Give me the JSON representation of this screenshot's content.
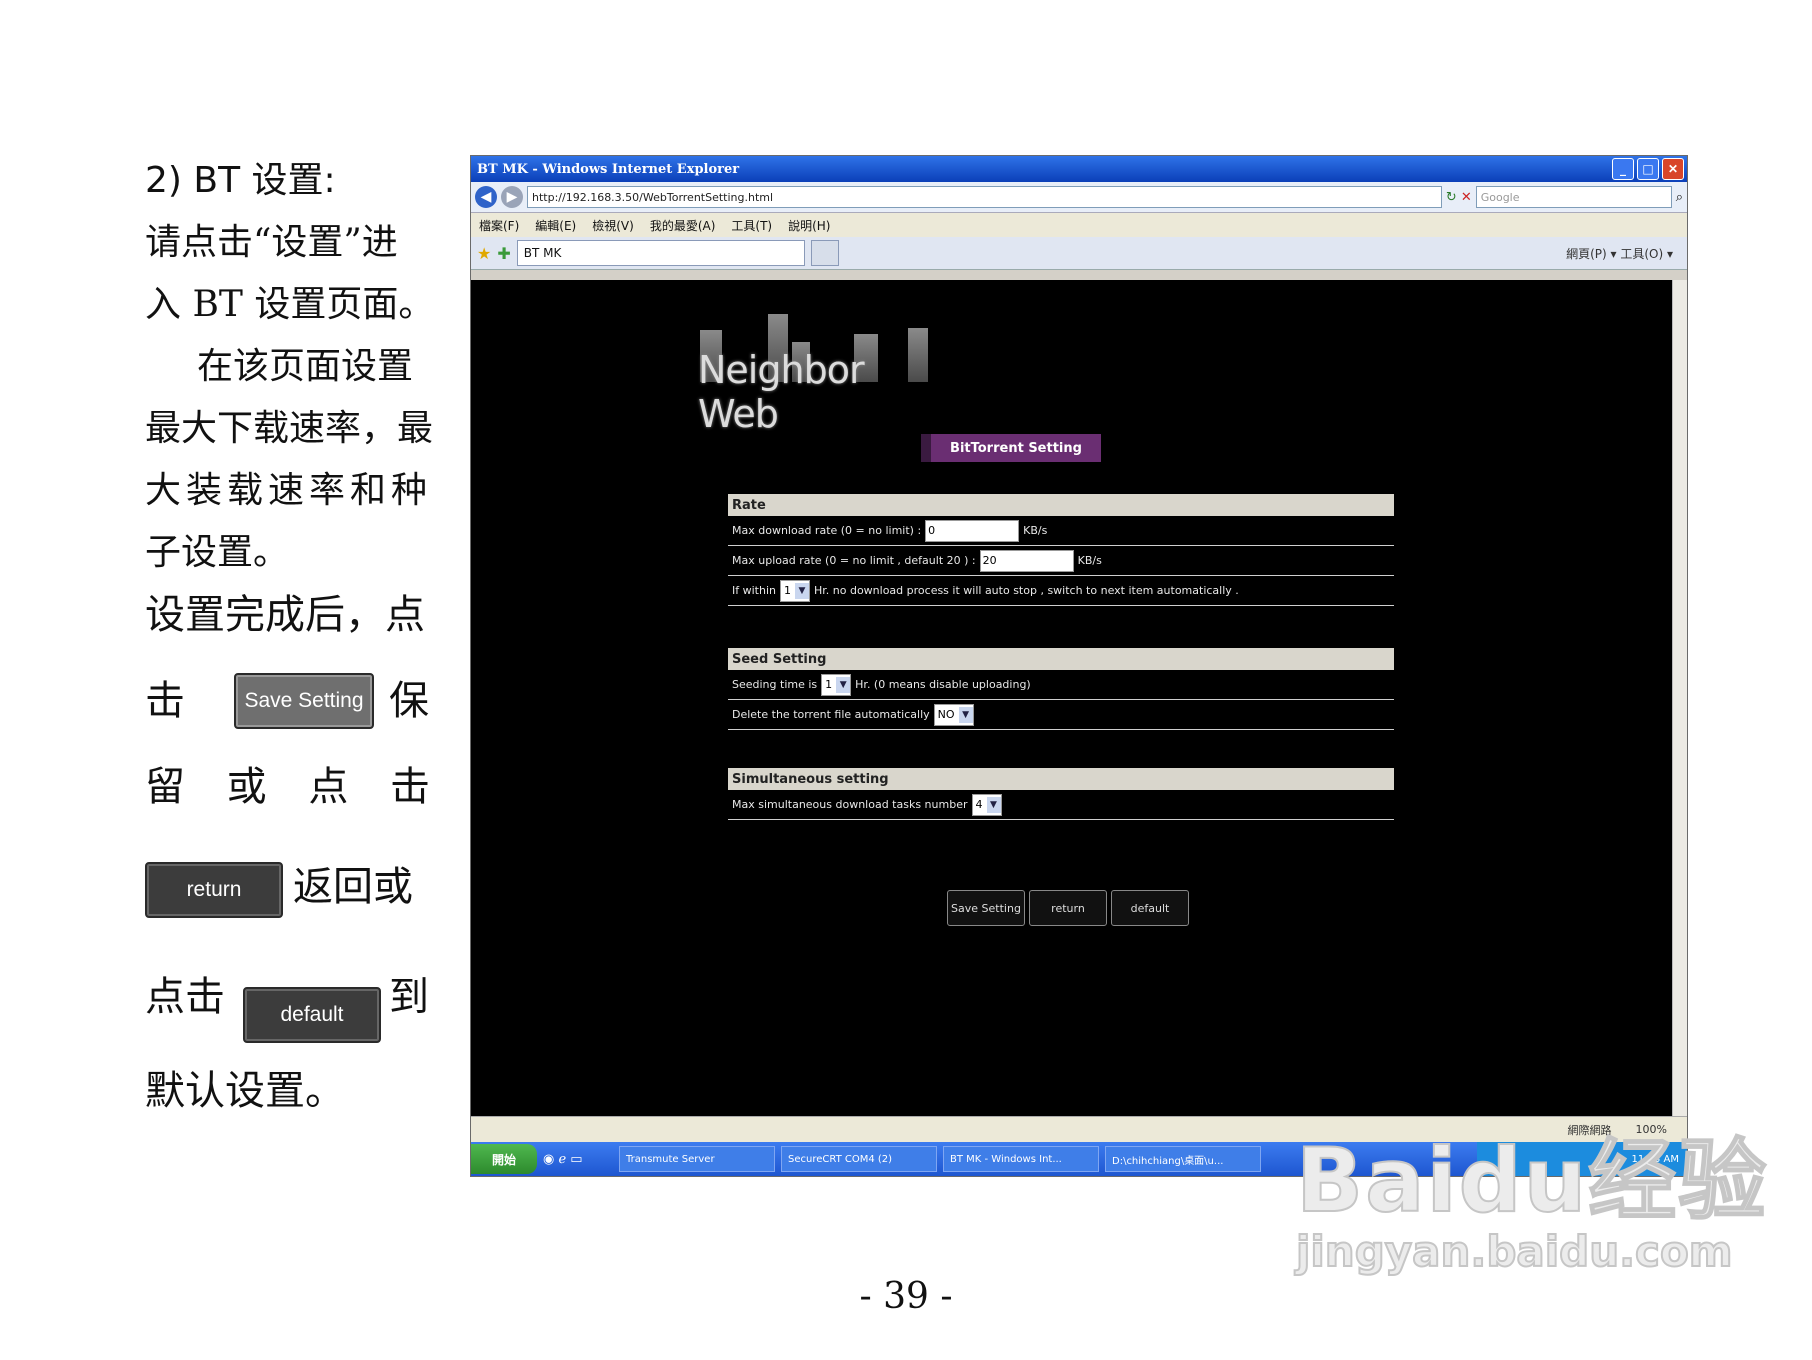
{
  "manual": {
    "heading": "2)    BT  设置:",
    "line1": "请点击“设置”进",
    "line2": "入 BT 设置页面。",
    "line3": "在该页面设置",
    "line4": "最大下载速率，最",
    "line5": "大装载速率和种",
    "line6": "子设置。",
    "line7": "设置完成后，点",
    "click1": "击",
    "keep": "保",
    "row_words": [
      "留",
      "或",
      "点",
      "击"
    ],
    "return_tail": "返回或",
    "click2": "点击",
    "to": "到",
    "last": "默认设置。",
    "btn_save": "Save Setting",
    "btn_return": "return",
    "btn_default": "default"
  },
  "page_number": "- 39 -",
  "browser": {
    "title": "BT MK - Windows Internet Explorer",
    "url": "http://192.168.3.50/WebTorrentSetting.html",
    "search_placeholder": "Google",
    "menu": [
      "檔案(F)",
      "編輯(E)",
      "檢視(V)",
      "我的最愛(A)",
      "工具(T)",
      "說明(H)"
    ],
    "tab": "BT MK",
    "tools": "網頁(P) ▾  工具(O) ▾",
    "status_zoom": "100%",
    "status_zone": "網際網路"
  },
  "web": {
    "logo": "Neighbor Web",
    "banner": "BitTorrent Setting",
    "rate_header": "Rate",
    "max_download_label": "Max download rate (0 = no limit) :",
    "max_download_value": "0",
    "unit1": "KB/s",
    "max_upload_label": "Max upload rate (0 = no limit , default 20 ) :",
    "max_upload_value": "20",
    "unit2": "KB/s",
    "within_label": "If within",
    "within_value": "1",
    "within_tail": "Hr. no download process it will auto stop , switch to next item automatically .",
    "seed_header": "Seed Setting",
    "seeding_label": "Seeding time is",
    "seeding_value": "1",
    "seeding_tail": "Hr. (0 means disable uploading)",
    "delete_label": "Delete the torrent file automatically",
    "delete_value": "NO",
    "simul_header": "Simultaneous setting",
    "simul_label": "Max simultaneous download tasks number",
    "simul_value": "4",
    "btn_save": "Save Setting",
    "btn_return": "return",
    "btn_default": "default"
  },
  "taskbar": {
    "start": "開始",
    "tasks": [
      "Transmute Server",
      "SecureCRT COM4 (2)",
      "BT MK - Windows Int...",
      "D:\\chihchiang\\桌面\\u..."
    ],
    "clock": "11:03 AM"
  },
  "watermark": {
    "brand": "Baidu经验",
    "url": "jingyan.baidu.com"
  }
}
